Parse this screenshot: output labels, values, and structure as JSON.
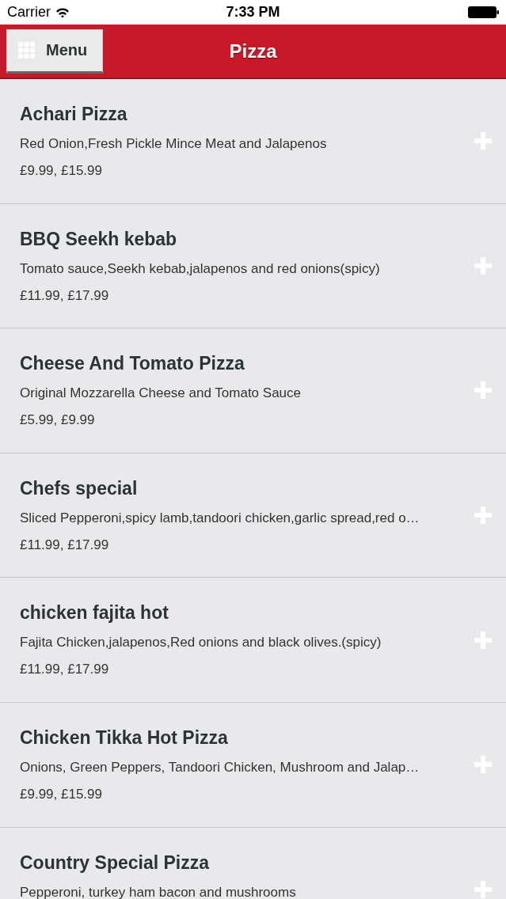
{
  "status_bar": {
    "carrier": "Carrier",
    "time": "7:33 PM"
  },
  "header": {
    "menu_button": "Menu",
    "title": "Pizza"
  },
  "items": [
    {
      "name": "Achari Pizza",
      "description": "Red Onion,Fresh Pickle Mince Meat and Jalapenos",
      "price": "£9.99, £15.99"
    },
    {
      "name": "BBQ Seekh kebab",
      "description": "Tomato sauce,Seekh kebab,jalapenos and red onions(spicy)",
      "price": "£11.99, £17.99"
    },
    {
      "name": "Cheese And Tomato Pizza",
      "description": "Original Mozzarella Cheese and Tomato Sauce",
      "price": "£5.99, £9.99"
    },
    {
      "name": "Chefs special",
      "description": "Sliced Pepperoni,spicy lamb,tandoori chicken,garlic spread,red o…",
      "price": "£11.99, £17.99"
    },
    {
      "name": "chicken fajita hot",
      "description": "Fajita Chicken,jalapenos,Red onions and black olives.(spicy)",
      "price": "£11.99, £17.99"
    },
    {
      "name": "Chicken Tikka Hot Pizza",
      "description": "Onions, Green Peppers, Tandoori Chicken, Mushroom and Jalap…",
      "price": "£9.99, £15.99"
    },
    {
      "name": "Country Special Pizza",
      "description": "Pepperoni, turkey ham bacon and mushrooms"
    }
  ]
}
